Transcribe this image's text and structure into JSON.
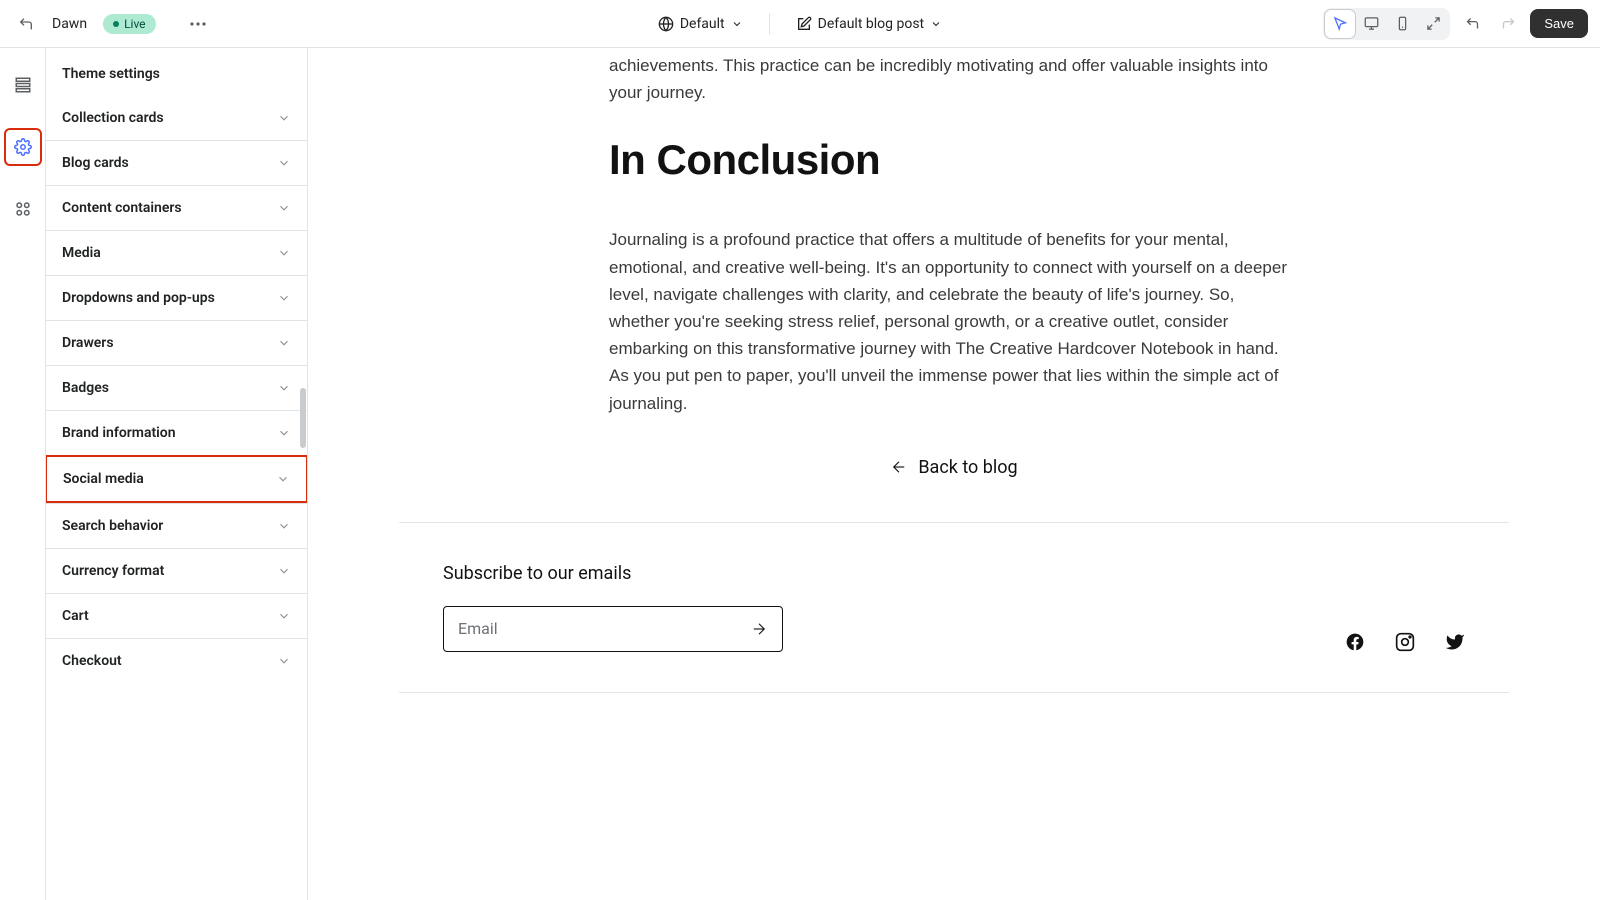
{
  "topbar": {
    "theme_name": "Dawn",
    "status_label": "Live",
    "template_selector": "Default",
    "page_selector": "Default blog post",
    "save_label": "Save"
  },
  "sidebar": {
    "title": "Theme settings",
    "items": [
      {
        "label": "Collection cards"
      },
      {
        "label": "Blog cards"
      },
      {
        "label": "Content containers"
      },
      {
        "label": "Media"
      },
      {
        "label": "Dropdowns and pop-ups"
      },
      {
        "label": "Drawers"
      },
      {
        "label": "Badges"
      },
      {
        "label": "Brand information"
      },
      {
        "label": "Social media"
      },
      {
        "label": "Search behavior"
      },
      {
        "label": "Currency format"
      },
      {
        "label": "Cart"
      },
      {
        "label": "Checkout"
      }
    ]
  },
  "preview": {
    "article": {
      "p1": "achievements. This practice can be incredibly motivating and offer valuable insights into your journey.",
      "h2": "In Conclusion",
      "p2": "Journaling is a profound practice that offers a multitude of benefits for your mental, emotional, and creative well-being. It's an opportunity to connect with yourself on a deeper level, navigate challenges with clarity, and celebrate the beauty of life's journey. So, whether you're seeking stress relief, personal growth, or a creative outlet, consider embarking on this transformative journey with The Creative Hardcover Notebook in hand. As you put pen to paper, you'll unveil the immense power that lies within the simple act of journaling.",
      "back_label": "Back to blog"
    },
    "footer": {
      "subscribe_title": "Subscribe to our emails",
      "email_placeholder": "Email"
    }
  }
}
